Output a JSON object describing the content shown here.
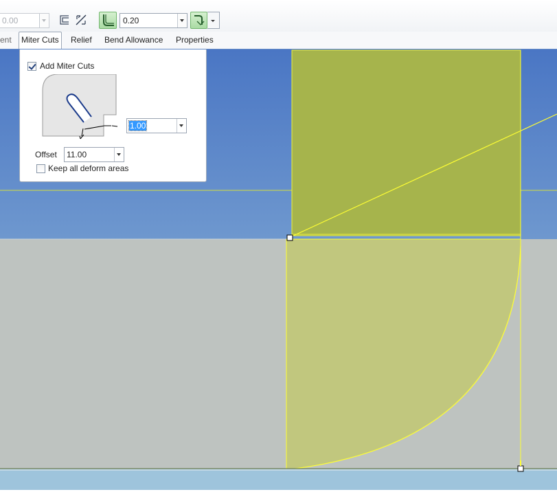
{
  "toolbar": {
    "disabled_value": "0.00",
    "thickness_value": "0.20"
  },
  "tabs": [
    {
      "label": "ent"
    },
    {
      "label": "Miter Cuts"
    },
    {
      "label": "Relief"
    },
    {
      "label": "Bend Allowance"
    },
    {
      "label": "Properties"
    }
  ],
  "miter_panel": {
    "add_miter_label": "Add Miter Cuts",
    "add_miter_checked": true,
    "width_value": "1.00",
    "offset_label": "Offset",
    "offset_value": "11.00",
    "keep_deform_label": "Keep all deform areas",
    "keep_deform_checked": false
  },
  "colors": {
    "viewport_top": "#4a76c4",
    "viewport_bottom": "#9ec4dc",
    "sheet_fill": "#bec3c0",
    "highlight_fill": "#a6b44c",
    "selection_edge": "#ffff33",
    "toggle_active": "#a9dba3"
  }
}
